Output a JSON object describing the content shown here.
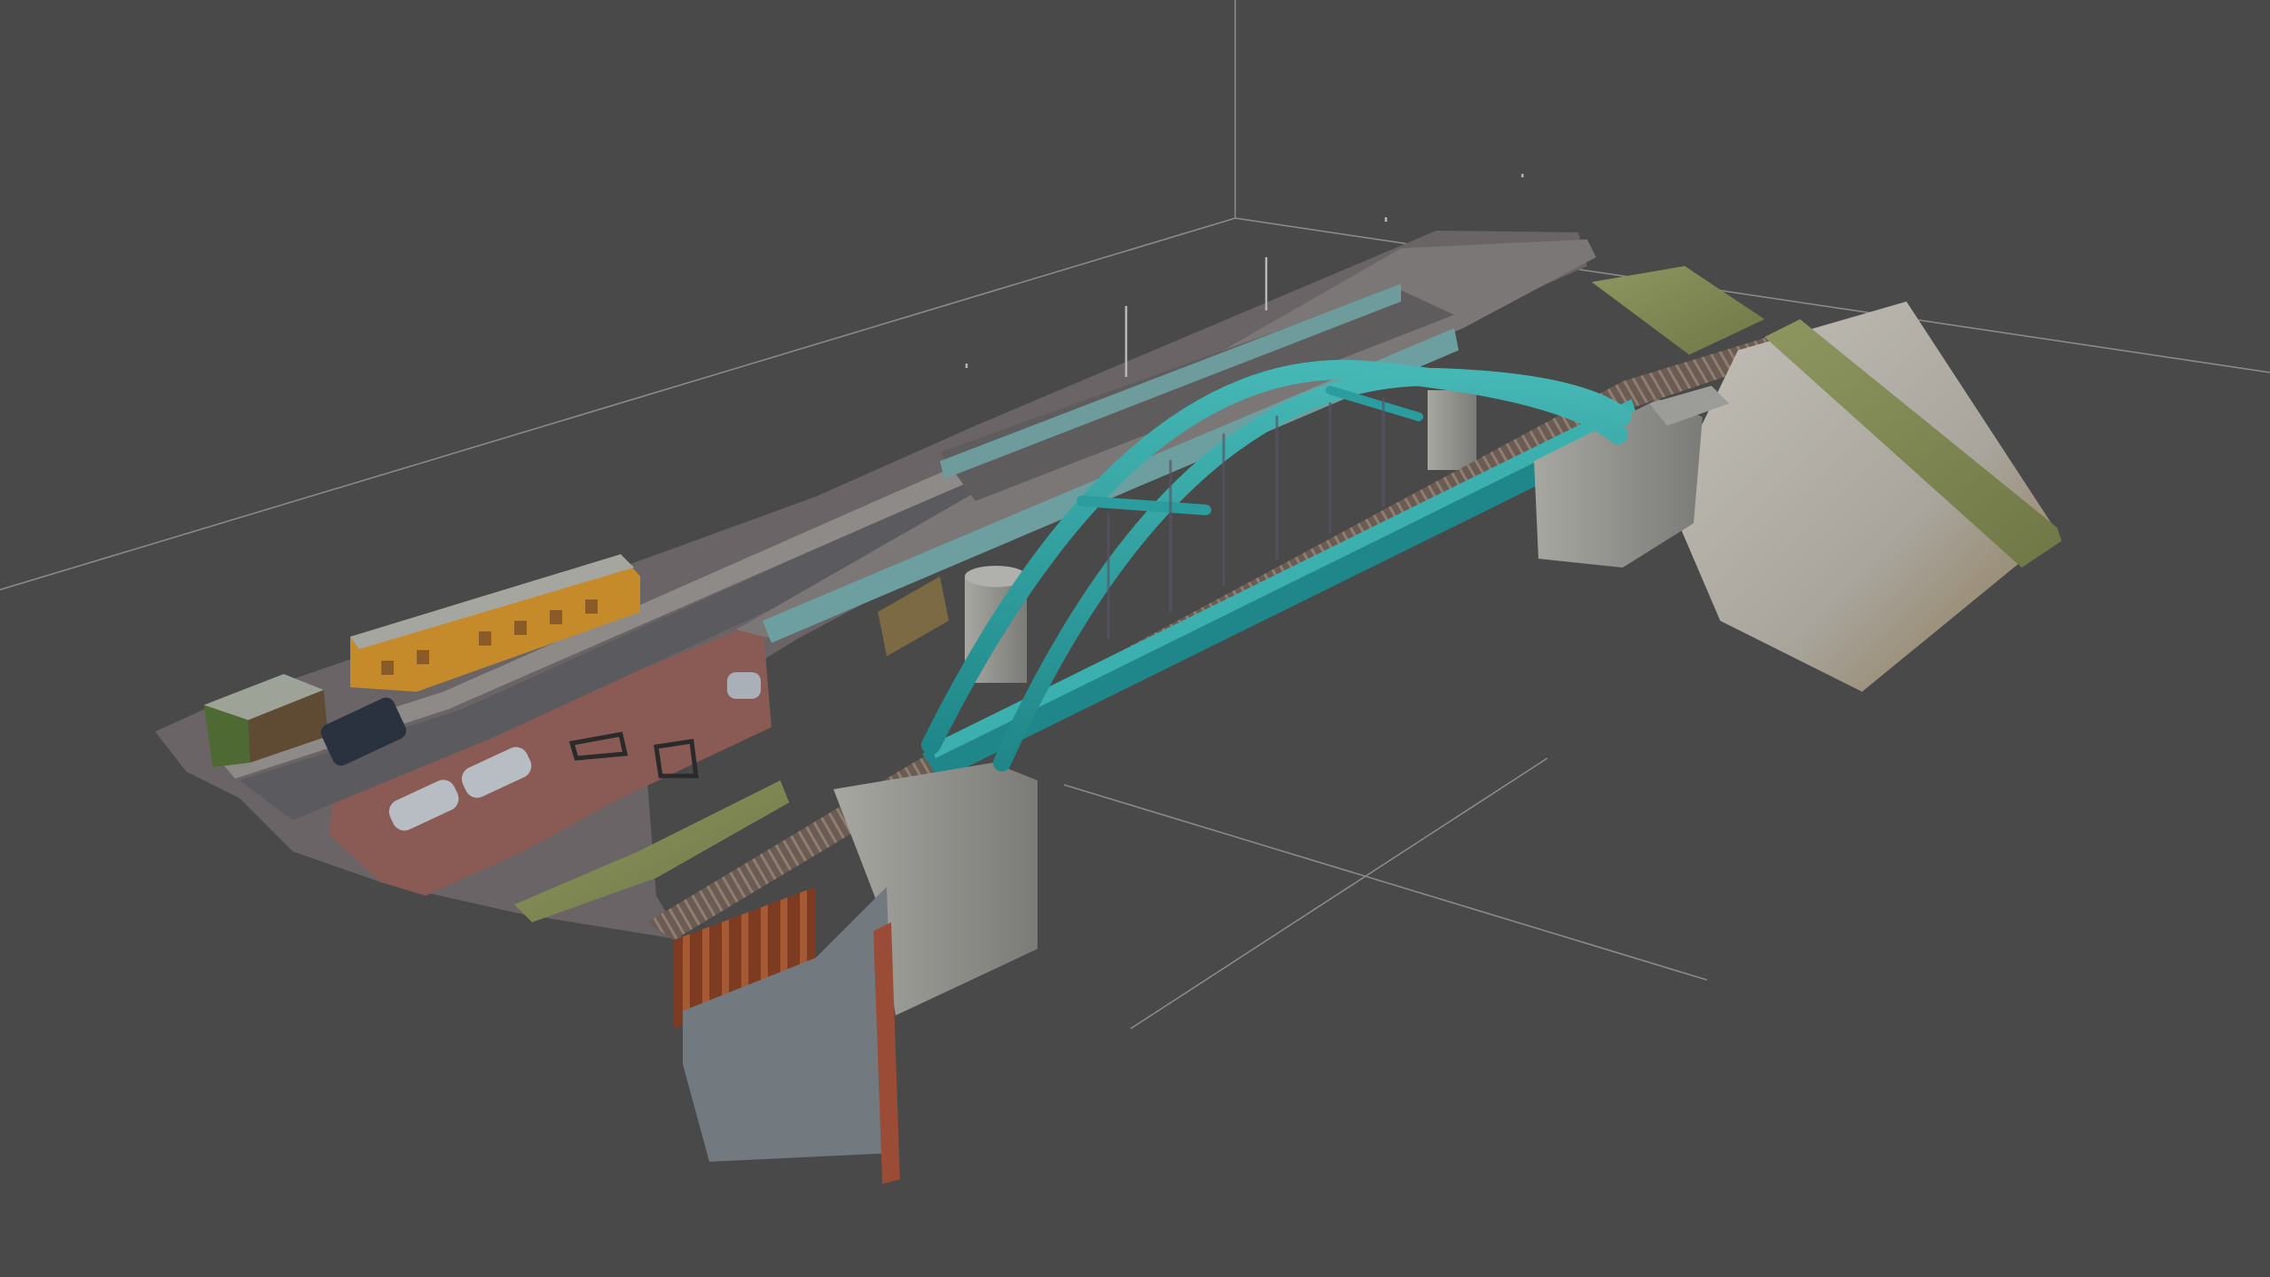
{
  "viewport": {
    "background": "#494949",
    "grid_color": "#8a8a8a"
  },
  "model": {
    "subject": "arch-bridge-point-cloud",
    "palette": {
      "arch": "#2fa3a4",
      "arch_dark": "#1e7d80",
      "concrete": "#9a9a96",
      "road": "#6a6466",
      "road_red": "#8a5a55",
      "grass": "#7f8a55",
      "building": "#c58a2a",
      "gravel": "#b5b2ab",
      "rust": "#8a4a2a"
    }
  }
}
